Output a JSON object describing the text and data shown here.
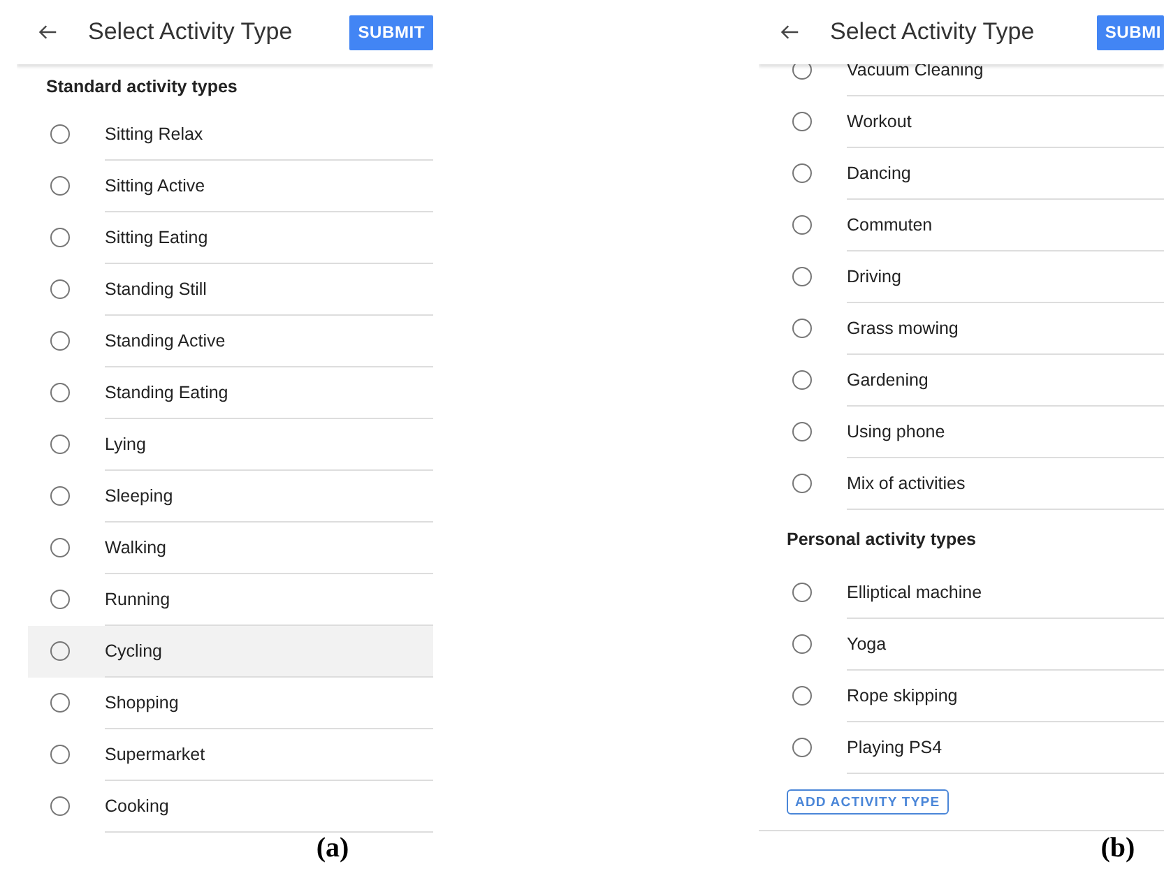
{
  "panels": [
    {
      "title": "Select Activity Type",
      "submit": "SUBMIT",
      "scrolled": false,
      "caption": "(a)",
      "items": [
        {
          "kind": "section",
          "label": "Standard activity types"
        },
        {
          "kind": "option",
          "label": "Sitting Relax",
          "selected": false,
          "highlighted": false
        },
        {
          "kind": "option",
          "label": "Sitting Active",
          "selected": false,
          "highlighted": false
        },
        {
          "kind": "option",
          "label": "Sitting Eating",
          "selected": false,
          "highlighted": false
        },
        {
          "kind": "option",
          "label": "Standing Still",
          "selected": false,
          "highlighted": false
        },
        {
          "kind": "option",
          "label": "Standing Active",
          "selected": false,
          "highlighted": false
        },
        {
          "kind": "option",
          "label": "Standing Eating",
          "selected": false,
          "highlighted": false
        },
        {
          "kind": "option",
          "label": "Lying",
          "selected": false,
          "highlighted": false
        },
        {
          "kind": "option",
          "label": "Sleeping",
          "selected": false,
          "highlighted": false
        },
        {
          "kind": "option",
          "label": "Walking",
          "selected": false,
          "highlighted": false
        },
        {
          "kind": "option",
          "label": "Running",
          "selected": false,
          "highlighted": false
        },
        {
          "kind": "option",
          "label": "Cycling",
          "selected": false,
          "highlighted": true
        },
        {
          "kind": "option",
          "label": "Shopping",
          "selected": false,
          "highlighted": false
        },
        {
          "kind": "option",
          "label": "Supermarket",
          "selected": false,
          "highlighted": false
        },
        {
          "kind": "option",
          "label": "Cooking",
          "selected": false,
          "highlighted": false
        }
      ]
    },
    {
      "title": "Select Activity Type",
      "submit": "SUBMI",
      "scrolled": true,
      "caption": "(b)",
      "items": [
        {
          "kind": "option",
          "label": "Vacuum Cleaning",
          "selected": false,
          "highlighted": false
        },
        {
          "kind": "option",
          "label": "Workout",
          "selected": false,
          "highlighted": false
        },
        {
          "kind": "option",
          "label": "Dancing",
          "selected": false,
          "highlighted": false
        },
        {
          "kind": "option",
          "label": "Commuten",
          "selected": false,
          "highlighted": false
        },
        {
          "kind": "option",
          "label": "Driving",
          "selected": false,
          "highlighted": false
        },
        {
          "kind": "option",
          "label": "Grass mowing",
          "selected": false,
          "highlighted": false
        },
        {
          "kind": "option",
          "label": "Gardening",
          "selected": false,
          "highlighted": false
        },
        {
          "kind": "option",
          "label": "Using phone",
          "selected": false,
          "highlighted": false
        },
        {
          "kind": "option",
          "label": "Mix of activities",
          "selected": false,
          "highlighted": false
        },
        {
          "kind": "section",
          "label": "Personal activity types"
        },
        {
          "kind": "option",
          "label": "Elliptical machine",
          "selected": false,
          "highlighted": false
        },
        {
          "kind": "option",
          "label": "Yoga",
          "selected": false,
          "highlighted": false
        },
        {
          "kind": "option",
          "label": "Rope skipping",
          "selected": false,
          "highlighted": false
        },
        {
          "kind": "option",
          "label": "Playing PS4",
          "selected": false,
          "highlighted": false
        },
        {
          "kind": "add_button",
          "label": "ADD ACTIVITY TYPE"
        }
      ]
    }
  ]
}
